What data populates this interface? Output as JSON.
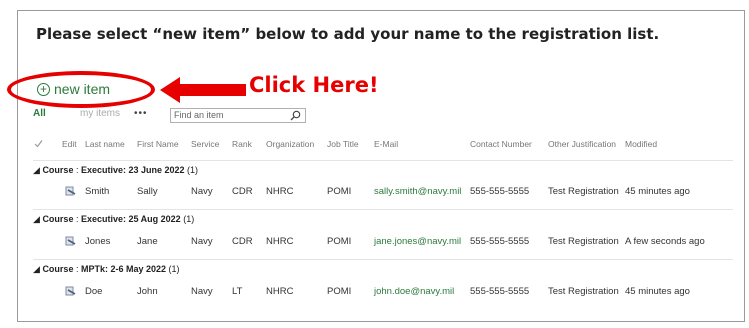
{
  "instruction": "Please select “new item” below to add your name to the registration list.",
  "new_item_label": "new item",
  "annotation": {
    "callout": "Click Here!",
    "color": "#e60000"
  },
  "toolbar": {
    "view_all": "All",
    "view_faded": "my items",
    "more": "•••",
    "search_placeholder": "Find an item"
  },
  "columns": [
    "Edit",
    "Last name",
    "First Name",
    "Service",
    "Rank",
    "Organization",
    "Job Title",
    "E-Mail",
    "Contact Number",
    "Other Justification",
    "Modified"
  ],
  "groups": [
    {
      "label": "Course",
      "name": "Executive: 23 June 2022",
      "count": "(1)",
      "row": {
        "last": "Smith",
        "first": "Sally",
        "service": "Navy",
        "rank": "CDR",
        "org": "NHRC",
        "job": "POMI",
        "email": "sally.smith@navy.mil",
        "phone": "555-555-5555",
        "just": "Test Registration",
        "modified": "45 minutes ago"
      }
    },
    {
      "label": "Course",
      "name": "Executive: 25 Aug 2022",
      "count": "(1)",
      "row": {
        "last": "Jones",
        "first": "Jane",
        "service": "Navy",
        "rank": "CDR",
        "org": "NHRC",
        "job": "POMI",
        "email": "jane.jones@navy.mil",
        "phone": "555-555-5555",
        "just": "Test Registration",
        "modified": "A few seconds ago"
      }
    },
    {
      "label": "Course",
      "name": "MPTk: 2-6 May 2022",
      "count": "(1)",
      "row": {
        "last": "Doe",
        "first": "John",
        "service": "Navy",
        "rank": "LT",
        "org": "NHRC",
        "job": "POMI",
        "email": "john.doe@navy.mil",
        "phone": "555-555-5555",
        "just": "Test Registration",
        "modified": "45 minutes ago"
      }
    }
  ],
  "colors": {
    "accent_green": "#2d7a3d",
    "border": "#9a9a9a"
  }
}
